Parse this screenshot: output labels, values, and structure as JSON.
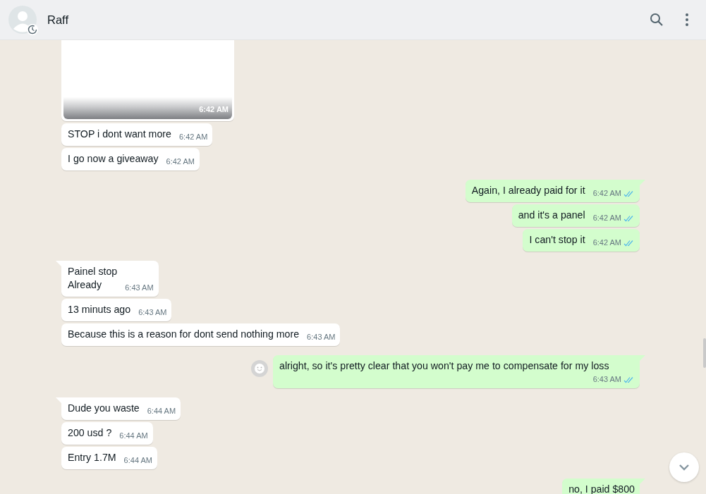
{
  "header": {
    "contact_name": "Raff"
  },
  "messages": [
    {
      "kind": "image",
      "outgoing": false,
      "time": "6:42 AM"
    },
    {
      "kind": "text",
      "outgoing": false,
      "tail": false,
      "text": "STOP i dont want more",
      "time": "6:42 AM"
    },
    {
      "kind": "text",
      "outgoing": false,
      "tail": false,
      "text": "I go now a giveaway",
      "time": "6:42 AM"
    },
    {
      "kind": "text",
      "outgoing": true,
      "tail": true,
      "text": "Again, I already paid for it",
      "time": "6:42 AM",
      "read": true
    },
    {
      "kind": "text",
      "outgoing": true,
      "tail": false,
      "text": "and it's a panel",
      "time": "6:42 AM",
      "read": true
    },
    {
      "kind": "text",
      "outgoing": true,
      "tail": false,
      "text": "I can't stop it",
      "time": "6:42 AM",
      "read": true
    },
    {
      "kind": "text",
      "outgoing": false,
      "tail": true,
      "text": "Painel stop\nAlready",
      "time": "6:43 AM"
    },
    {
      "kind": "text",
      "outgoing": false,
      "tail": false,
      "text": "13 minuts ago",
      "time": "6:43 AM"
    },
    {
      "kind": "text",
      "outgoing": false,
      "tail": false,
      "text": "Because this is a reason for dont send nothing more",
      "time": "6:43 AM"
    },
    {
      "kind": "text",
      "outgoing": true,
      "tail": true,
      "text": "alright, so it's pretty clear that you won't pay me to compensate for my loss",
      "time": "6:43 AM",
      "read": true,
      "emoji_button": true
    },
    {
      "kind": "text",
      "outgoing": false,
      "tail": true,
      "text": "Dude you waste",
      "time": "6:44 AM"
    },
    {
      "kind": "text",
      "outgoing": false,
      "tail": false,
      "text": "200 usd ?",
      "time": "6:44 AM"
    },
    {
      "kind": "text",
      "outgoing": false,
      "tail": false,
      "text": "Entry 1.7M",
      "time": "6:44 AM"
    },
    {
      "kind": "cut",
      "outgoing": true,
      "tail": true,
      "text": "no, I paid $800"
    }
  ]
}
